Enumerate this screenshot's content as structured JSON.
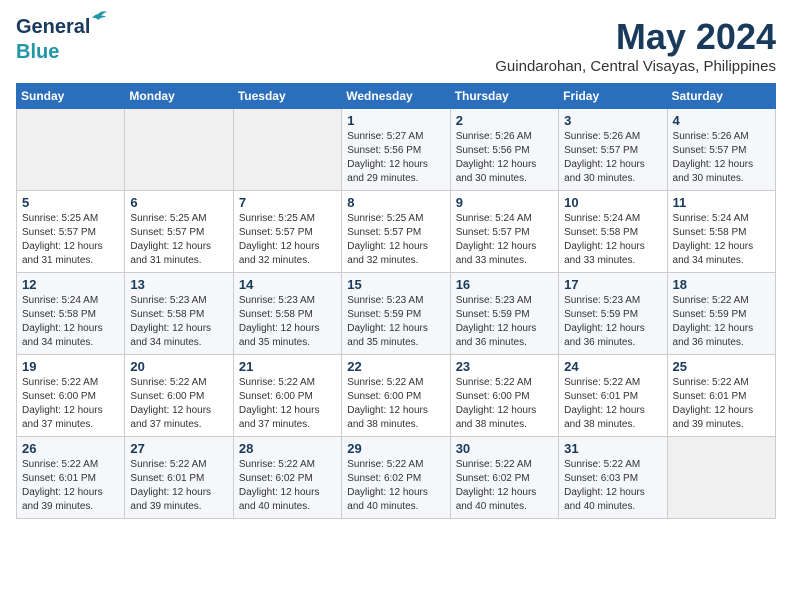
{
  "logo": {
    "line1": "General",
    "line2": "Blue"
  },
  "title": "May 2024",
  "subtitle": "Guindarohan, Central Visayas, Philippines",
  "header": {
    "days": [
      "Sunday",
      "Monday",
      "Tuesday",
      "Wednesday",
      "Thursday",
      "Friday",
      "Saturday"
    ]
  },
  "weeks": [
    {
      "cells": [
        {
          "num": "",
          "info": ""
        },
        {
          "num": "",
          "info": ""
        },
        {
          "num": "",
          "info": ""
        },
        {
          "num": "1",
          "info": "Sunrise: 5:27 AM\nSunset: 5:56 PM\nDaylight: 12 hours\nand 29 minutes."
        },
        {
          "num": "2",
          "info": "Sunrise: 5:26 AM\nSunset: 5:56 PM\nDaylight: 12 hours\nand 30 minutes."
        },
        {
          "num": "3",
          "info": "Sunrise: 5:26 AM\nSunset: 5:57 PM\nDaylight: 12 hours\nand 30 minutes."
        },
        {
          "num": "4",
          "info": "Sunrise: 5:26 AM\nSunset: 5:57 PM\nDaylight: 12 hours\nand 30 minutes."
        }
      ]
    },
    {
      "cells": [
        {
          "num": "5",
          "info": "Sunrise: 5:25 AM\nSunset: 5:57 PM\nDaylight: 12 hours\nand 31 minutes."
        },
        {
          "num": "6",
          "info": "Sunrise: 5:25 AM\nSunset: 5:57 PM\nDaylight: 12 hours\nand 31 minutes."
        },
        {
          "num": "7",
          "info": "Sunrise: 5:25 AM\nSunset: 5:57 PM\nDaylight: 12 hours\nand 32 minutes."
        },
        {
          "num": "8",
          "info": "Sunrise: 5:25 AM\nSunset: 5:57 PM\nDaylight: 12 hours\nand 32 minutes."
        },
        {
          "num": "9",
          "info": "Sunrise: 5:24 AM\nSunset: 5:57 PM\nDaylight: 12 hours\nand 33 minutes."
        },
        {
          "num": "10",
          "info": "Sunrise: 5:24 AM\nSunset: 5:58 PM\nDaylight: 12 hours\nand 33 minutes."
        },
        {
          "num": "11",
          "info": "Sunrise: 5:24 AM\nSunset: 5:58 PM\nDaylight: 12 hours\nand 34 minutes."
        }
      ]
    },
    {
      "cells": [
        {
          "num": "12",
          "info": "Sunrise: 5:24 AM\nSunset: 5:58 PM\nDaylight: 12 hours\nand 34 minutes."
        },
        {
          "num": "13",
          "info": "Sunrise: 5:23 AM\nSunset: 5:58 PM\nDaylight: 12 hours\nand 34 minutes."
        },
        {
          "num": "14",
          "info": "Sunrise: 5:23 AM\nSunset: 5:58 PM\nDaylight: 12 hours\nand 35 minutes."
        },
        {
          "num": "15",
          "info": "Sunrise: 5:23 AM\nSunset: 5:59 PM\nDaylight: 12 hours\nand 35 minutes."
        },
        {
          "num": "16",
          "info": "Sunrise: 5:23 AM\nSunset: 5:59 PM\nDaylight: 12 hours\nand 36 minutes."
        },
        {
          "num": "17",
          "info": "Sunrise: 5:23 AM\nSunset: 5:59 PM\nDaylight: 12 hours\nand 36 minutes."
        },
        {
          "num": "18",
          "info": "Sunrise: 5:22 AM\nSunset: 5:59 PM\nDaylight: 12 hours\nand 36 minutes."
        }
      ]
    },
    {
      "cells": [
        {
          "num": "19",
          "info": "Sunrise: 5:22 AM\nSunset: 6:00 PM\nDaylight: 12 hours\nand 37 minutes."
        },
        {
          "num": "20",
          "info": "Sunrise: 5:22 AM\nSunset: 6:00 PM\nDaylight: 12 hours\nand 37 minutes."
        },
        {
          "num": "21",
          "info": "Sunrise: 5:22 AM\nSunset: 6:00 PM\nDaylight: 12 hours\nand 37 minutes."
        },
        {
          "num": "22",
          "info": "Sunrise: 5:22 AM\nSunset: 6:00 PM\nDaylight: 12 hours\nand 38 minutes."
        },
        {
          "num": "23",
          "info": "Sunrise: 5:22 AM\nSunset: 6:00 PM\nDaylight: 12 hours\nand 38 minutes."
        },
        {
          "num": "24",
          "info": "Sunrise: 5:22 AM\nSunset: 6:01 PM\nDaylight: 12 hours\nand 38 minutes."
        },
        {
          "num": "25",
          "info": "Sunrise: 5:22 AM\nSunset: 6:01 PM\nDaylight: 12 hours\nand 39 minutes."
        }
      ]
    },
    {
      "cells": [
        {
          "num": "26",
          "info": "Sunrise: 5:22 AM\nSunset: 6:01 PM\nDaylight: 12 hours\nand 39 minutes."
        },
        {
          "num": "27",
          "info": "Sunrise: 5:22 AM\nSunset: 6:01 PM\nDaylight: 12 hours\nand 39 minutes."
        },
        {
          "num": "28",
          "info": "Sunrise: 5:22 AM\nSunset: 6:02 PM\nDaylight: 12 hours\nand 40 minutes."
        },
        {
          "num": "29",
          "info": "Sunrise: 5:22 AM\nSunset: 6:02 PM\nDaylight: 12 hours\nand 40 minutes."
        },
        {
          "num": "30",
          "info": "Sunrise: 5:22 AM\nSunset: 6:02 PM\nDaylight: 12 hours\nand 40 minutes."
        },
        {
          "num": "31",
          "info": "Sunrise: 5:22 AM\nSunset: 6:03 PM\nDaylight: 12 hours\nand 40 minutes."
        },
        {
          "num": "",
          "info": ""
        }
      ]
    }
  ]
}
